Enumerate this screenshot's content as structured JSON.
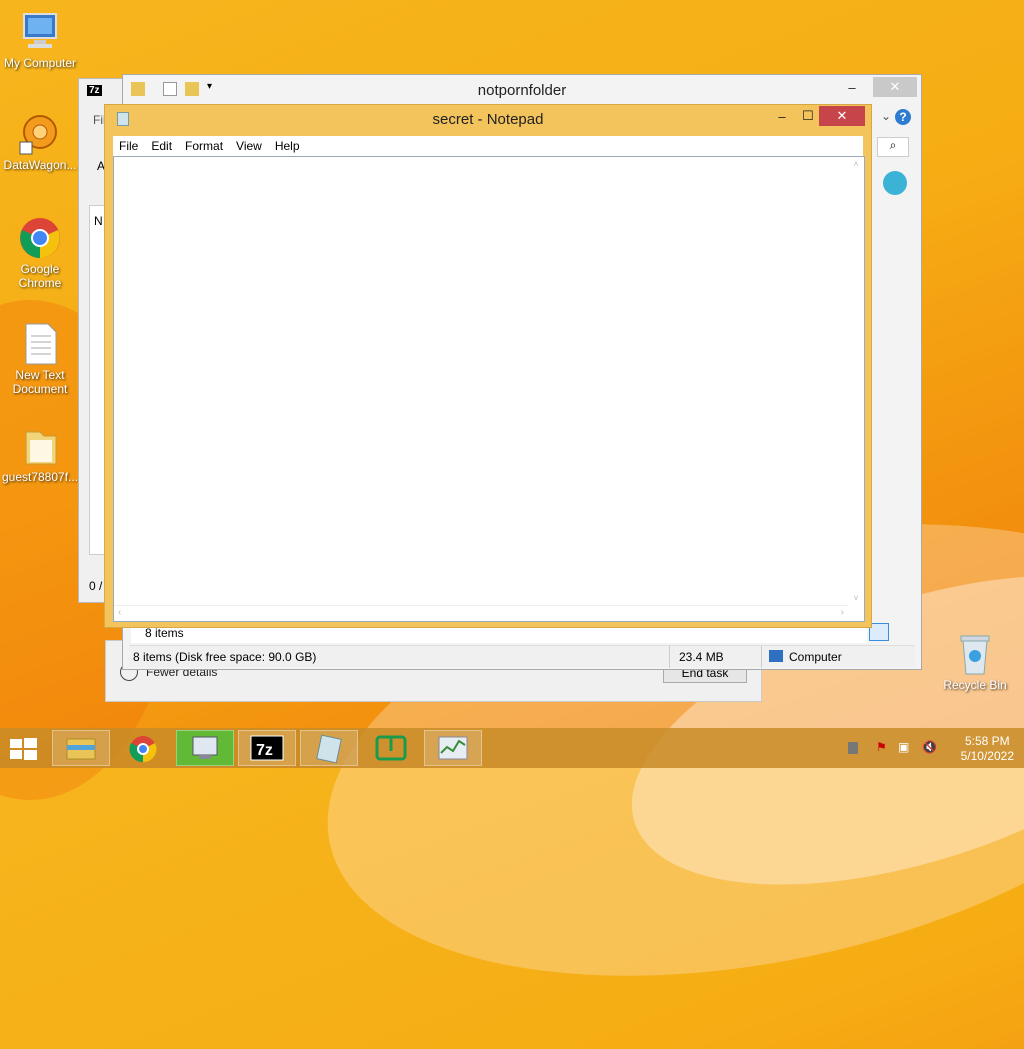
{
  "desktop": {
    "icons": [
      {
        "label": "My Computer",
        "icon": "computer-icon"
      },
      {
        "label": "DataWagon...",
        "icon": "datawagon-icon"
      },
      {
        "label": "Google\nChrome",
        "icon": "chrome-icon"
      },
      {
        "label": "New Text\nDocument",
        "icon": "text-file-icon"
      },
      {
        "label": "guest78807f...",
        "icon": "folder-icon"
      },
      {
        "label": "Recycle Bin",
        "icon": "recycle-bin-icon"
      }
    ]
  },
  "sevenzip": {
    "logo": "7z",
    "partial_labels": [
      "Fil",
      "A",
      "N",
      "0 /"
    ]
  },
  "explorer": {
    "title": "notpornfolder",
    "items_count": "8 items",
    "status": {
      "items": "8 items (Disk free space: 90.0 GB)",
      "size": "23.4 MB",
      "location": "Computer"
    }
  },
  "taskmanager": {
    "partial_label": "Fewer details",
    "end_task": "End task"
  },
  "notepad": {
    "title": "secret - Notepad",
    "menu": [
      "File",
      "Edit",
      "Format",
      "View",
      "Help"
    ],
    "content": ""
  },
  "taskbar": {
    "time": "5:58 PM",
    "date": "5/10/2022",
    "apps": [
      "file-explorer-icon",
      "chrome-icon",
      "remote-desktop-icon",
      "7zip-icon",
      "notepad-icon",
      "screen-app-icon",
      "task-manager-icon"
    ]
  },
  "colors": {
    "accent": "#f3c35c",
    "close": "#c7454a",
    "taskbar_active": "#3ec83e"
  }
}
